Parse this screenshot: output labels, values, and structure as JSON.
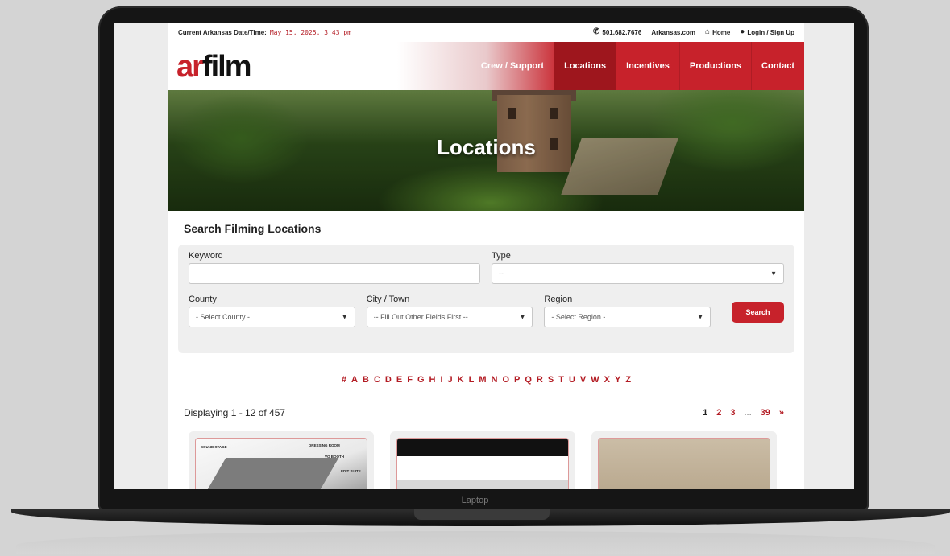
{
  "device": {
    "label": "Laptop"
  },
  "topbar": {
    "datetime_label": "Current Arkansas Date/Time:",
    "datetime_value": "May 15, 2025, 3:43 pm",
    "phone": "501.682.7676",
    "arkansas_link": "Arkansas.com",
    "home_link": "Home",
    "login_link": "Login / Sign Up"
  },
  "logo": {
    "part1": "ar",
    "part2": "film"
  },
  "nav": {
    "items": [
      {
        "label": "Crew / Support"
      },
      {
        "label": "Locations"
      },
      {
        "label": "Incentives"
      },
      {
        "label": "Productions"
      },
      {
        "label": "Contact"
      }
    ],
    "active": "Locations"
  },
  "hero": {
    "title": "Locations"
  },
  "search": {
    "heading": "Search Filming Locations",
    "keyword_label": "Keyword",
    "keyword_value": "",
    "type_label": "Type",
    "type_value": "--",
    "county_label": "County",
    "county_value": "- Select County -",
    "city_label": "City / Town",
    "city_value": "-- Fill Out Other Fields First --",
    "region_label": "Region",
    "region_value": "- Select Region -",
    "button_label": "Search"
  },
  "alphabet": [
    "#",
    "A",
    "B",
    "C",
    "D",
    "E",
    "F",
    "G",
    "H",
    "I",
    "J",
    "K",
    "L",
    "M",
    "N",
    "O",
    "P",
    "Q",
    "R",
    "S",
    "T",
    "U",
    "V",
    "W",
    "X",
    "Y",
    "Z"
  ],
  "results": {
    "count_text": "Displaying 1 - 12 of 457",
    "pages": [
      "1",
      "2",
      "3",
      "...",
      "39",
      "»"
    ]
  },
  "cards": {
    "card1_labels": [
      "SOUND STAGE",
      "DRESSING ROOM",
      "VO BOOTH",
      "EDIT SUITE"
    ]
  },
  "colors": {
    "brand_red": "#c7222b",
    "active_nav": "#9e161d",
    "link_red": "#b31b23"
  }
}
